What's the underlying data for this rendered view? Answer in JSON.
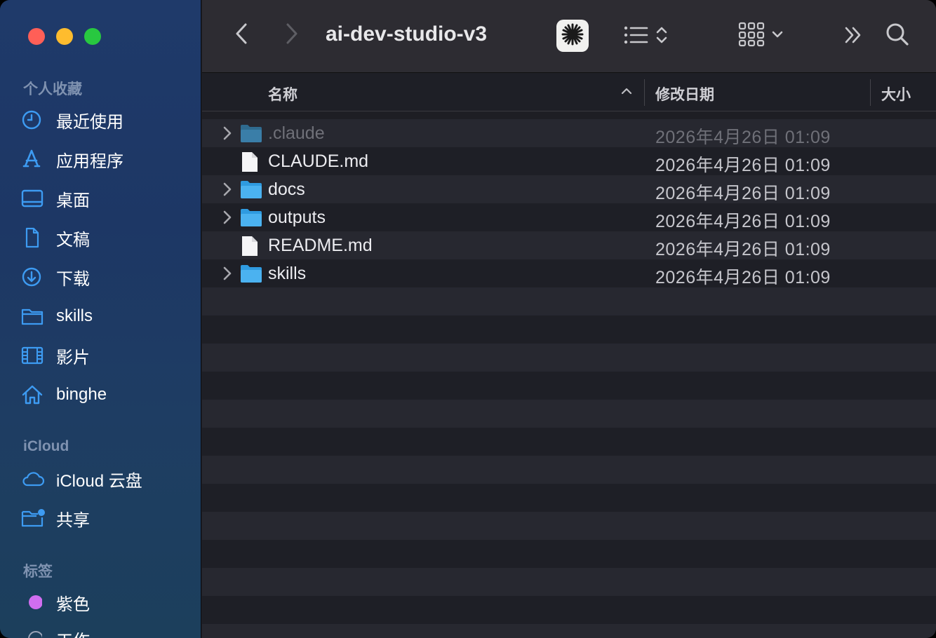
{
  "toolbar": {
    "title": "ai-dev-studio-v3"
  },
  "sidebar": {
    "favorites_title": "个人收藏",
    "favorites": [
      {
        "label": "最近使用",
        "icon": "clock-icon"
      },
      {
        "label": "应用程序",
        "icon": "applications-icon"
      },
      {
        "label": "桌面",
        "icon": "desktop-icon"
      },
      {
        "label": "文稿",
        "icon": "document-icon"
      },
      {
        "label": "下载",
        "icon": "download-icon"
      },
      {
        "label": "skills",
        "icon": "folder-icon"
      },
      {
        "label": "影片",
        "icon": "film-icon"
      },
      {
        "label": "binghe",
        "icon": "home-icon"
      }
    ],
    "icloud_title": "iCloud",
    "icloud": [
      {
        "label": "iCloud 云盘",
        "icon": "cloud-icon"
      },
      {
        "label": "共享",
        "icon": "shared-folder-icon"
      }
    ],
    "tags_title": "标签",
    "tags": [
      {
        "label": "紫色",
        "color": "#d06ef0"
      },
      {
        "label": "工作",
        "color": "#9aa4b8"
      }
    ]
  },
  "columns": {
    "name": "名称",
    "date": "修改日期",
    "size": "大小"
  },
  "files": [
    {
      "name": ".claude",
      "date": "2026年4月26日 01:09",
      "type": "folder",
      "hidden": true
    },
    {
      "name": "CLAUDE.md",
      "date": "2026年4月26日 01:09",
      "type": "file",
      "hidden": false
    },
    {
      "name": "docs",
      "date": "2026年4月26日 01:09",
      "type": "folder",
      "hidden": false
    },
    {
      "name": "outputs",
      "date": "2026年4月26日 01:09",
      "type": "folder",
      "hidden": false
    },
    {
      "name": "README.md",
      "date": "2026年4月26日 01:09",
      "type": "file",
      "hidden": false
    },
    {
      "name": "skills",
      "date": "2026年4月26日 01:09",
      "type": "folder",
      "hidden": false
    }
  ],
  "colors": {
    "accent_blue": "#3d9bf2",
    "folder_blue": "#4bb2f0"
  }
}
